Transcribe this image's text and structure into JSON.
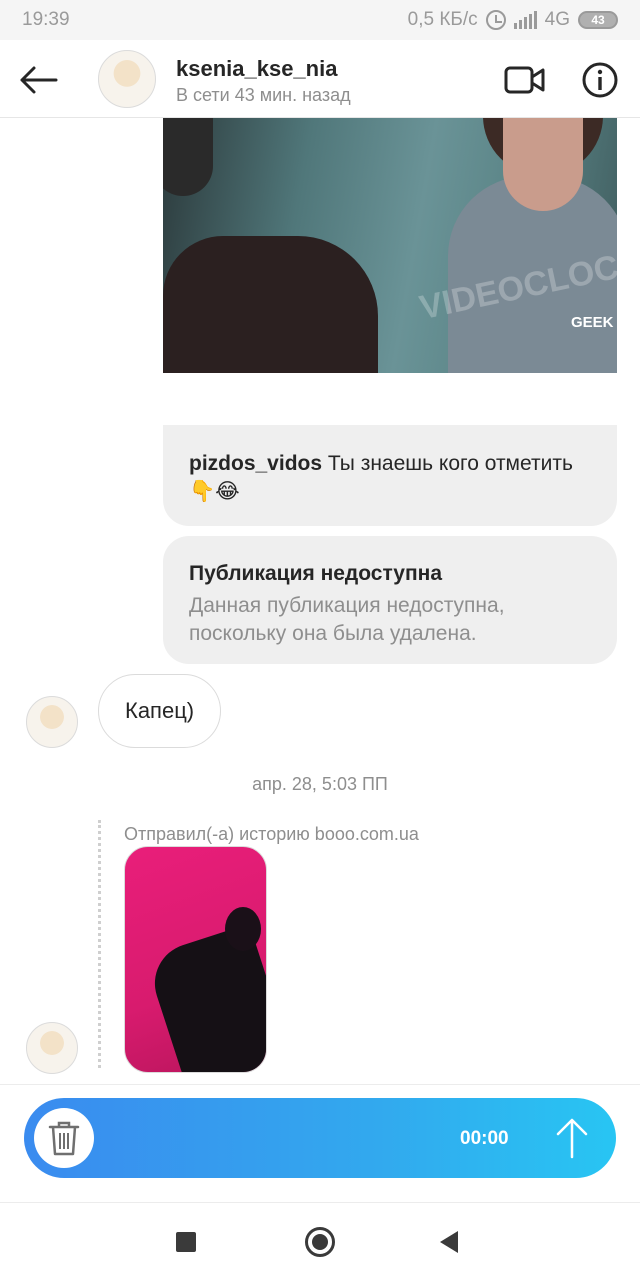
{
  "status_bar": {
    "time": "19:39",
    "speed": "0,5 КБ/с",
    "network": "4G",
    "battery": "43"
  },
  "header": {
    "username": "ksenia_kse_nia",
    "status": "В сети 43 мин. назад",
    "icons": [
      "back-arrow-icon",
      "video-call-icon",
      "info-icon"
    ]
  },
  "shared_post": {
    "video_watermark": "VIDEOCLOCK",
    "video_logo": "GEEK",
    "caption_author": "pizdos_vidos",
    "caption_text": " Ты знаешь кого отметить 👇😂"
  },
  "unavailable_post": {
    "title": "Публикация недоступна",
    "text": "Данная публикация недоступна, поскольку она была удалена."
  },
  "message": {
    "text": "Капец)"
  },
  "timestamp": "апр. 28, 5:03 ПП",
  "story_share": {
    "label": "Отправил(-а) историю booo.com.ua"
  },
  "recording": {
    "time": "00:00",
    "icons": [
      "trash-icon",
      "send-arrow-icon"
    ]
  },
  "colors": {
    "record_gradient_start": "#3a8bef",
    "record_gradient_end": "#28c5f3",
    "bubble_bg": "#efefef",
    "story_bg": "#e91e7a"
  }
}
